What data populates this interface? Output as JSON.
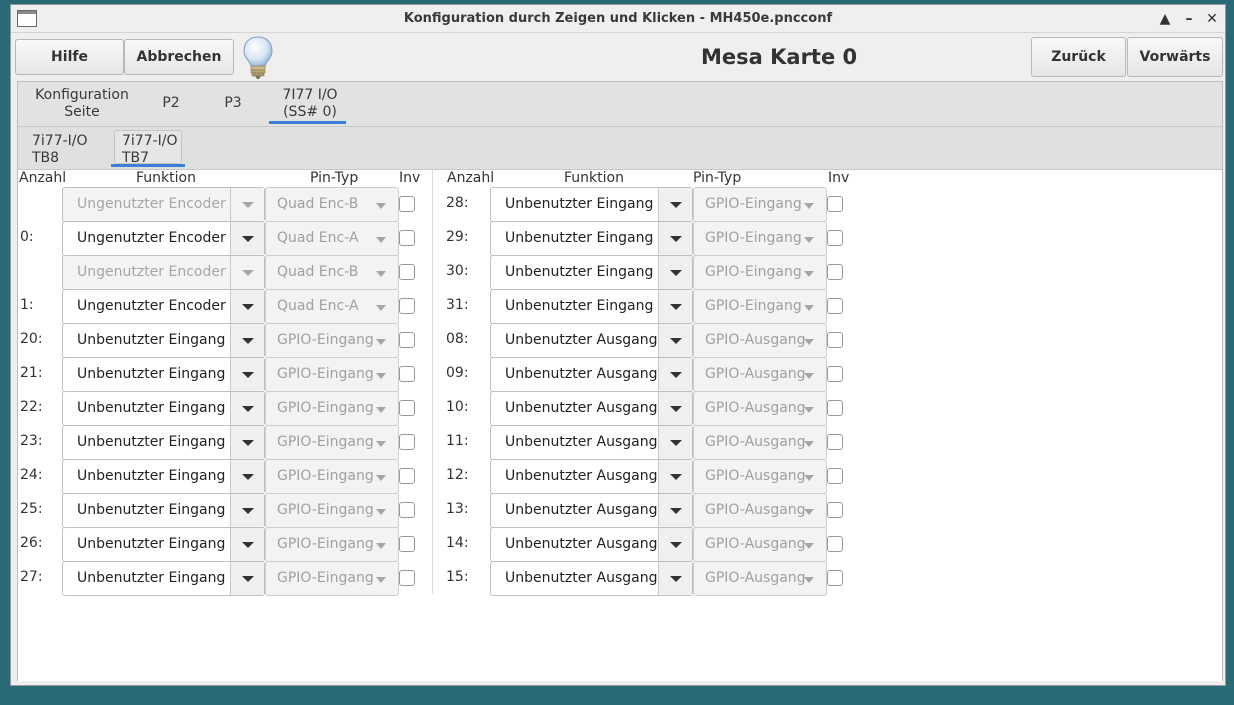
{
  "window": {
    "title": "Konfiguration durch Zeigen und Klicken - MH450e.pncconf",
    "controls": {
      "minimize": "–",
      "maximize": "▲",
      "close": "✕"
    }
  },
  "toolbar": {
    "help_label": "Hilfe",
    "cancel_label": "Abbrechen",
    "back_label": "Zurück",
    "forward_label": "Vorwärts",
    "card_title": "Mesa Karte 0"
  },
  "tabs": [
    {
      "label_line1": "Konfiguration",
      "label_line2": "Seite"
    },
    {
      "label_line1": "P2",
      "label_line2": ""
    },
    {
      "label_line1": "P3",
      "label_line2": ""
    },
    {
      "label_line1": "7I77 I/O",
      "label_line2": "(SS# 0)",
      "active": true
    }
  ],
  "subtabs": [
    {
      "label_line1": "7i77-I/O",
      "label_line2": "TB8"
    },
    {
      "label_line1": "7i77-I/O",
      "label_line2": "TB7",
      "active": true
    }
  ],
  "columns": {
    "count": "Anzahl",
    "function": "Funktion",
    "pin_type": "Pin-Typ",
    "inv": "Inv"
  },
  "left_rows": [
    {
      "label": "",
      "function": "Ungenutzter Encoder",
      "pin_type": "Quad Enc-B",
      "disabled": true
    },
    {
      "label": "0:",
      "function": "Ungenutzter Encoder",
      "pin_type": "Quad Enc-A",
      "disabled": false
    },
    {
      "label": "",
      "function": "Ungenutzter Encoder",
      "pin_type": "Quad Enc-B",
      "disabled": true
    },
    {
      "label": "1:",
      "function": "Ungenutzter Encoder",
      "pin_type": "Quad Enc-A",
      "disabled": false
    },
    {
      "label": "20:",
      "function": "Unbenutzter Eingang",
      "pin_type": "GPIO-Eingang",
      "disabled": false
    },
    {
      "label": "21:",
      "function": "Unbenutzter Eingang",
      "pin_type": "GPIO-Eingang",
      "disabled": false
    },
    {
      "label": "22:",
      "function": "Unbenutzter Eingang",
      "pin_type": "GPIO-Eingang",
      "disabled": false
    },
    {
      "label": "23:",
      "function": "Unbenutzter Eingang",
      "pin_type": "GPIO-Eingang",
      "disabled": false
    },
    {
      "label": "24:",
      "function": "Unbenutzter Eingang",
      "pin_type": "GPIO-Eingang",
      "disabled": false
    },
    {
      "label": "25:",
      "function": "Unbenutzter Eingang",
      "pin_type": "GPIO-Eingang",
      "disabled": false
    },
    {
      "label": "26:",
      "function": "Unbenutzter Eingang",
      "pin_type": "GPIO-Eingang",
      "disabled": false
    },
    {
      "label": "27:",
      "function": "Unbenutzter Eingang",
      "pin_type": "GPIO-Eingang",
      "disabled": false
    }
  ],
  "right_rows": [
    {
      "label": "28:",
      "function": "Unbenutzter Eingang",
      "pin_type": "GPIO-Eingang",
      "disabled": false
    },
    {
      "label": "29:",
      "function": "Unbenutzter Eingang",
      "pin_type": "GPIO-Eingang",
      "disabled": false
    },
    {
      "label": "30:",
      "function": "Unbenutzter Eingang",
      "pin_type": "GPIO-Eingang",
      "disabled": false
    },
    {
      "label": "31:",
      "function": "Unbenutzter Eingang",
      "pin_type": "GPIO-Eingang",
      "disabled": false
    },
    {
      "label": "08:",
      "function": "Unbenutzter Ausgang",
      "pin_type": "GPIO-Ausgang",
      "disabled": false
    },
    {
      "label": "09:",
      "function": "Unbenutzter Ausgang",
      "pin_type": "GPIO-Ausgang",
      "disabled": false
    },
    {
      "label": "10:",
      "function": "Unbenutzter Ausgang",
      "pin_type": "GPIO-Ausgang",
      "disabled": false
    },
    {
      "label": "11:",
      "function": "Unbenutzter Ausgang",
      "pin_type": "GPIO-Ausgang",
      "disabled": false
    },
    {
      "label": "12:",
      "function": "Unbenutzter Ausgang",
      "pin_type": "GPIO-Ausgang",
      "disabled": false
    },
    {
      "label": "13:",
      "function": "Unbenutzter Ausgang",
      "pin_type": "GPIO-Ausgang",
      "disabled": false
    },
    {
      "label": "14:",
      "function": "Unbenutzter Ausgang",
      "pin_type": "GPIO-Ausgang",
      "disabled": false
    },
    {
      "label": "15:",
      "function": "Unbenutzter Ausgang",
      "pin_type": "GPIO-Ausgang",
      "disabled": false
    }
  ],
  "colors": {
    "accent": "#3a81d5",
    "desktop": "#2a6a77"
  },
  "icons": {
    "window_icon": "window-icon",
    "help_bulb": "lightbulb-icon"
  }
}
